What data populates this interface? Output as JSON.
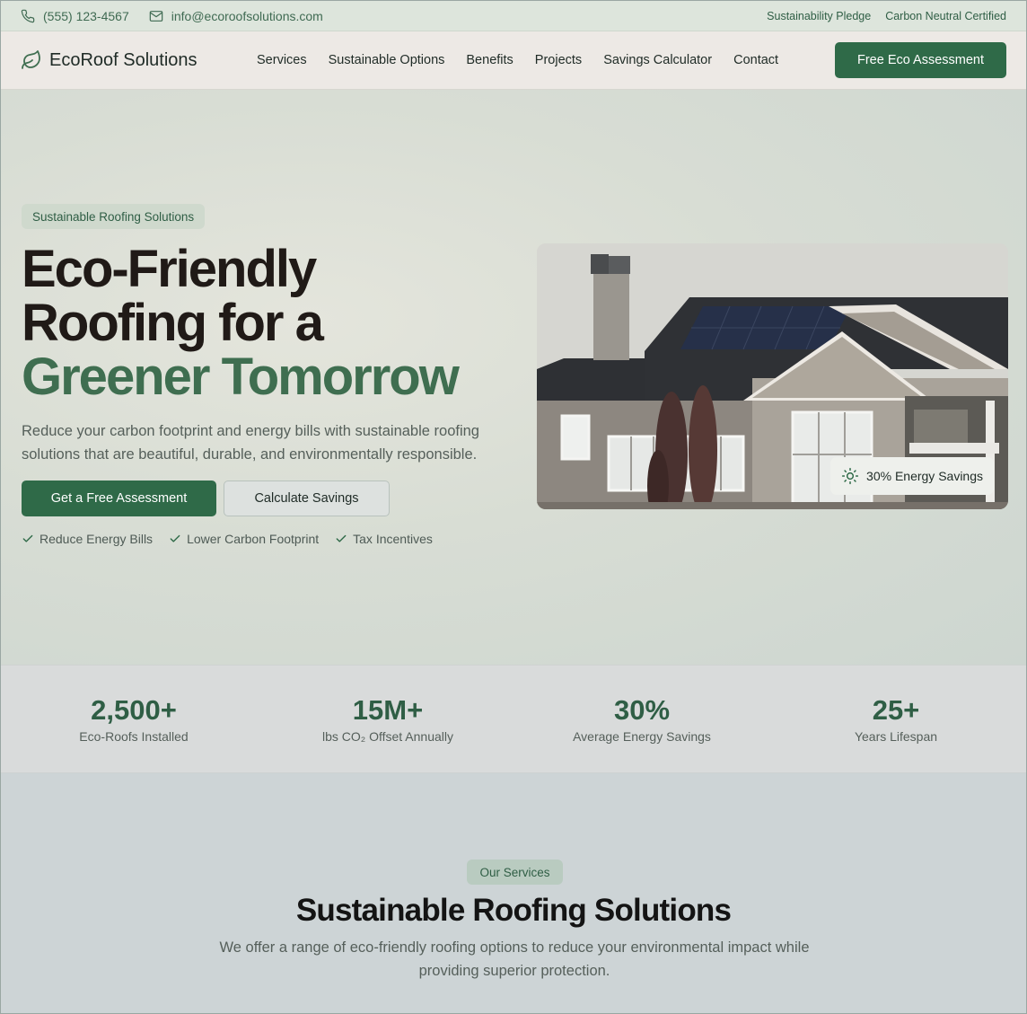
{
  "topbar": {
    "phone": "(555) 123-4567",
    "email": "info@ecoroofsolutions.com",
    "links": [
      "Sustainability Pledge",
      "Carbon Neutral Certified"
    ]
  },
  "header": {
    "brand": "EcoRoof Solutions",
    "nav": [
      "Services",
      "Sustainable Options",
      "Benefits",
      "Projects",
      "Savings Calculator",
      "Contact"
    ],
    "cta": "Free Eco Assessment"
  },
  "hero": {
    "badge": "Sustainable Roofing Solutions",
    "headline_line1": "Eco-Friendly",
    "headline_line2": "Roofing for a",
    "headline_highlight": "Greener Tomorrow",
    "subtitle": "Reduce your carbon footprint and energy bills with sustainable roofing solutions that are beautiful, durable, and environmentally responsible.",
    "primary_button": "Get a Free Assessment",
    "secondary_button": "Calculate Savings",
    "checks": [
      "Reduce Energy Bills",
      "Lower Carbon Footprint",
      "Tax Incentives"
    ],
    "image_badge": "30% Energy Savings"
  },
  "stats": [
    {
      "value": "2,500+",
      "label": "Eco-Roofs Installed"
    },
    {
      "value": "15M+",
      "label": "lbs CO₂ Offset Annually"
    },
    {
      "value": "30%",
      "label": "Average Energy Savings"
    },
    {
      "value": "25+",
      "label": "Years Lifespan"
    }
  ],
  "services": {
    "badge": "Our Services",
    "title": "Sustainable Roofing Solutions",
    "subtitle": "We offer a range of eco-friendly roofing options to reduce your environmental impact while providing superior protection."
  },
  "colors": {
    "brand_green": "#2f6a48",
    "accent_green": "#3f6e50",
    "text_dark": "#201a17"
  },
  "icons": [
    "phone-icon",
    "mail-icon",
    "leaf-icon",
    "check-icon",
    "sun-icon"
  ]
}
